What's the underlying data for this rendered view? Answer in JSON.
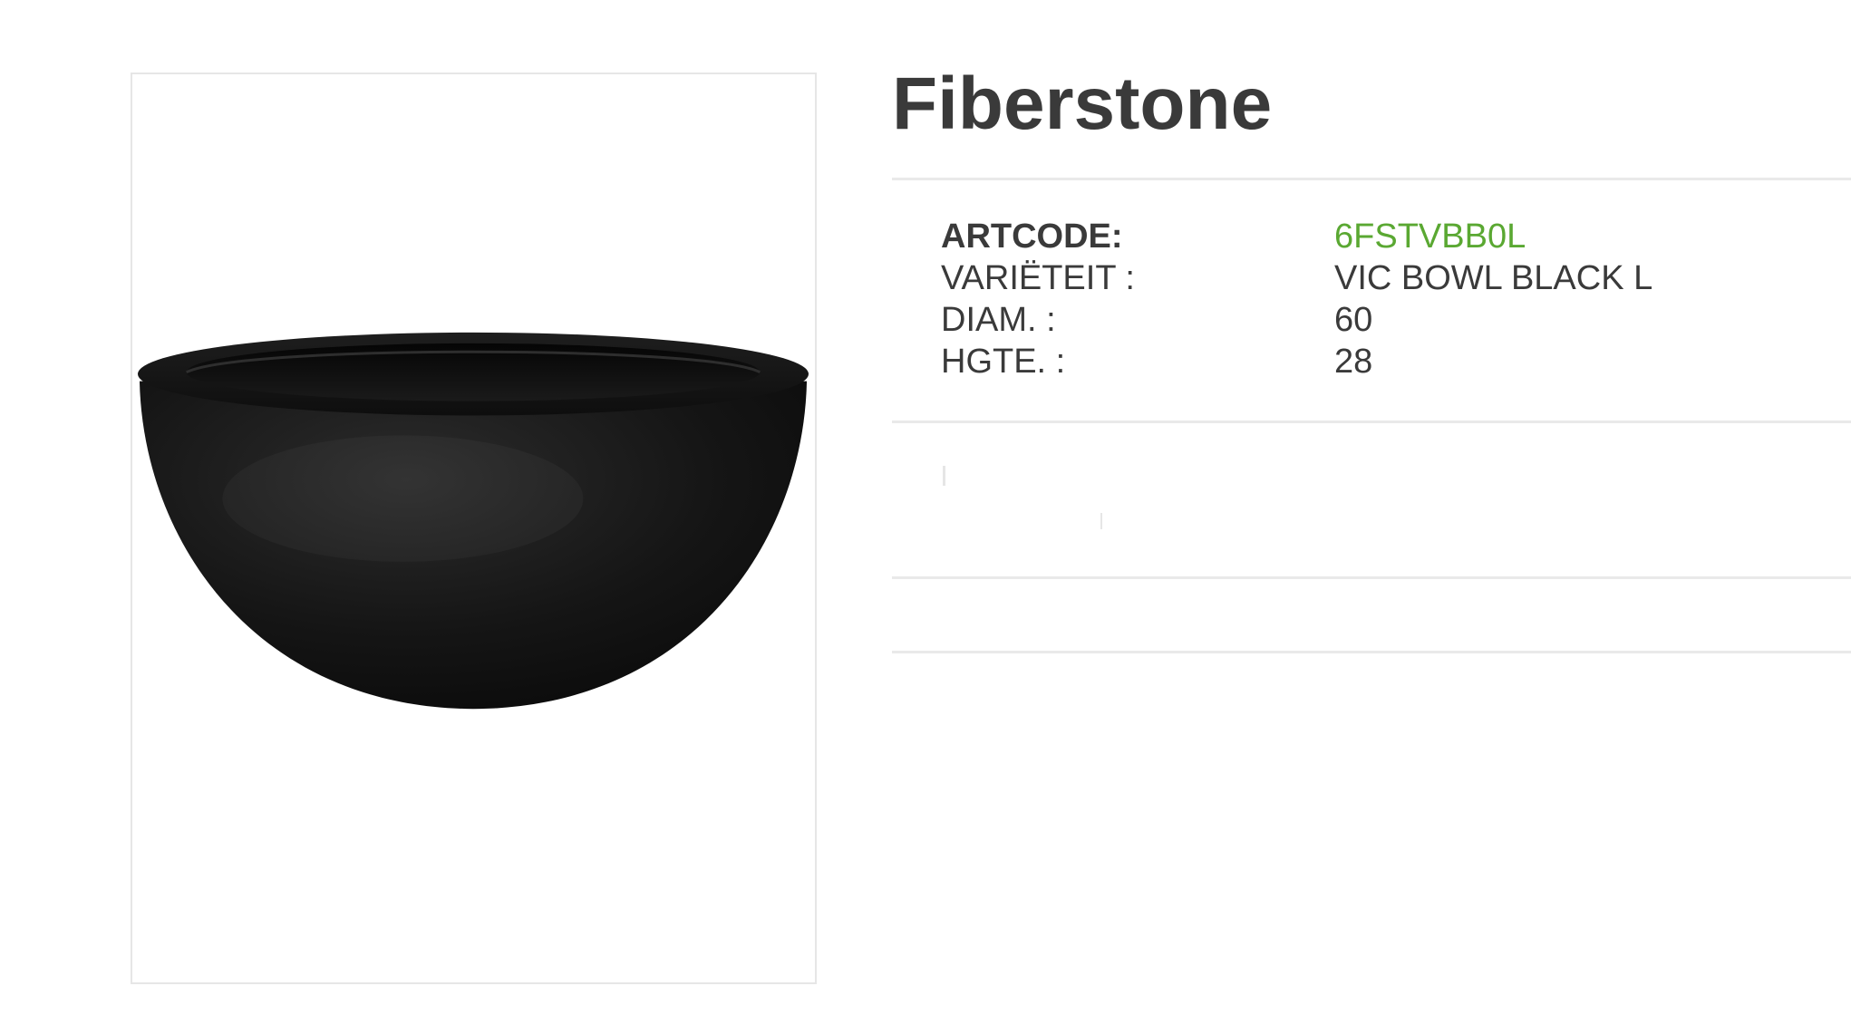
{
  "product": {
    "title": "Fiberstone",
    "specs": [
      {
        "label": "ARTCODE:",
        "value": "6FSTVBB0L",
        "emphasis": true
      },
      {
        "label": "VARIËTEIT :",
        "value": "VIC BOWL BLACK L",
        "emphasis": false
      },
      {
        "label": "DIAM. :",
        "value": "60",
        "emphasis": false
      },
      {
        "label": "HGTE. :",
        "value": "28",
        "emphasis": false
      }
    ],
    "image": {
      "subject": "black round fiberstone bowl planter"
    }
  },
  "colors": {
    "title": "#3a3a3a",
    "text": "#3a3a3a",
    "accent": "#5aa832",
    "divider": "#e9e9e9",
    "background": "#ffffff"
  }
}
